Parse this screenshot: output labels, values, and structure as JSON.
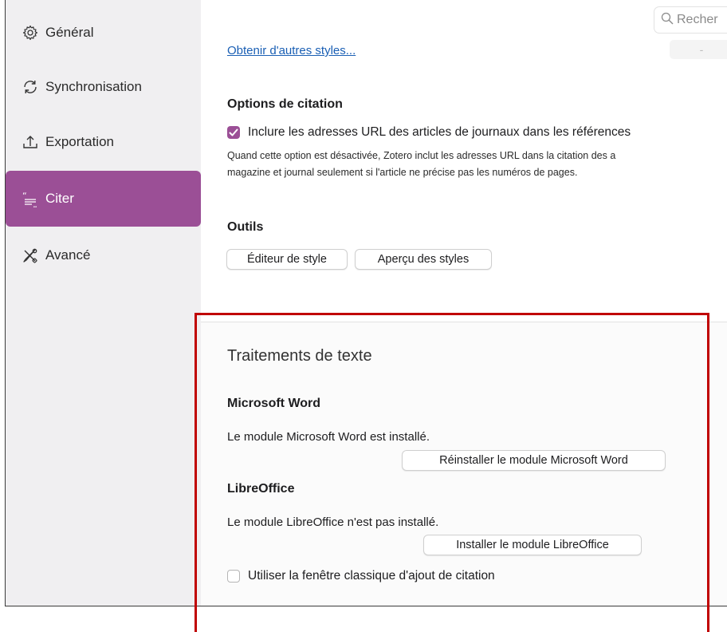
{
  "sidebar": {
    "items": [
      {
        "label": "Général",
        "icon": "gear-icon"
      },
      {
        "label": "Synchronisation",
        "icon": "sync-icon"
      },
      {
        "label": "Exportation",
        "icon": "export-icon"
      },
      {
        "label": "Citer",
        "icon": "citation-icon",
        "active": true
      },
      {
        "label": "Avancé",
        "icon": "tools-icon"
      }
    ]
  },
  "search": {
    "placeholder": "Recher"
  },
  "minus_button": {
    "label": "-"
  },
  "styles": {
    "get_more_link": "Obtenir d'autres styles..."
  },
  "citation_options": {
    "heading": "Options de citation",
    "include_urls_label": "Inclure les adresses URL des articles de journaux dans les références",
    "include_urls_checked": true,
    "description_line1": "Quand cette option est désactivée, Zotero inclut les adresses URL dans la citation des a",
    "description_line2": "magazine et journal seulement si l'article ne précise pas les numéros de pages."
  },
  "tools": {
    "heading": "Outils",
    "style_editor_button": "Éditeur de style",
    "style_preview_button": "Aperçu des styles"
  },
  "word_processors": {
    "heading": "Traitements de texte",
    "word": {
      "heading": "Microsoft Word",
      "status": "Le module Microsoft Word est installé.",
      "button": "Réinstaller le module Microsoft Word"
    },
    "libreoffice": {
      "heading": "LibreOffice",
      "status": "Le module LibreOffice n'est pas installé.",
      "button": "Installer le module LibreOffice"
    },
    "classic_dialog_label": "Utiliser la fenêtre classique d'ajout de citation",
    "classic_dialog_checked": false
  },
  "colors": {
    "accent": "#9b4f96",
    "link": "#1a5fb4",
    "highlight_border": "#c00000"
  }
}
